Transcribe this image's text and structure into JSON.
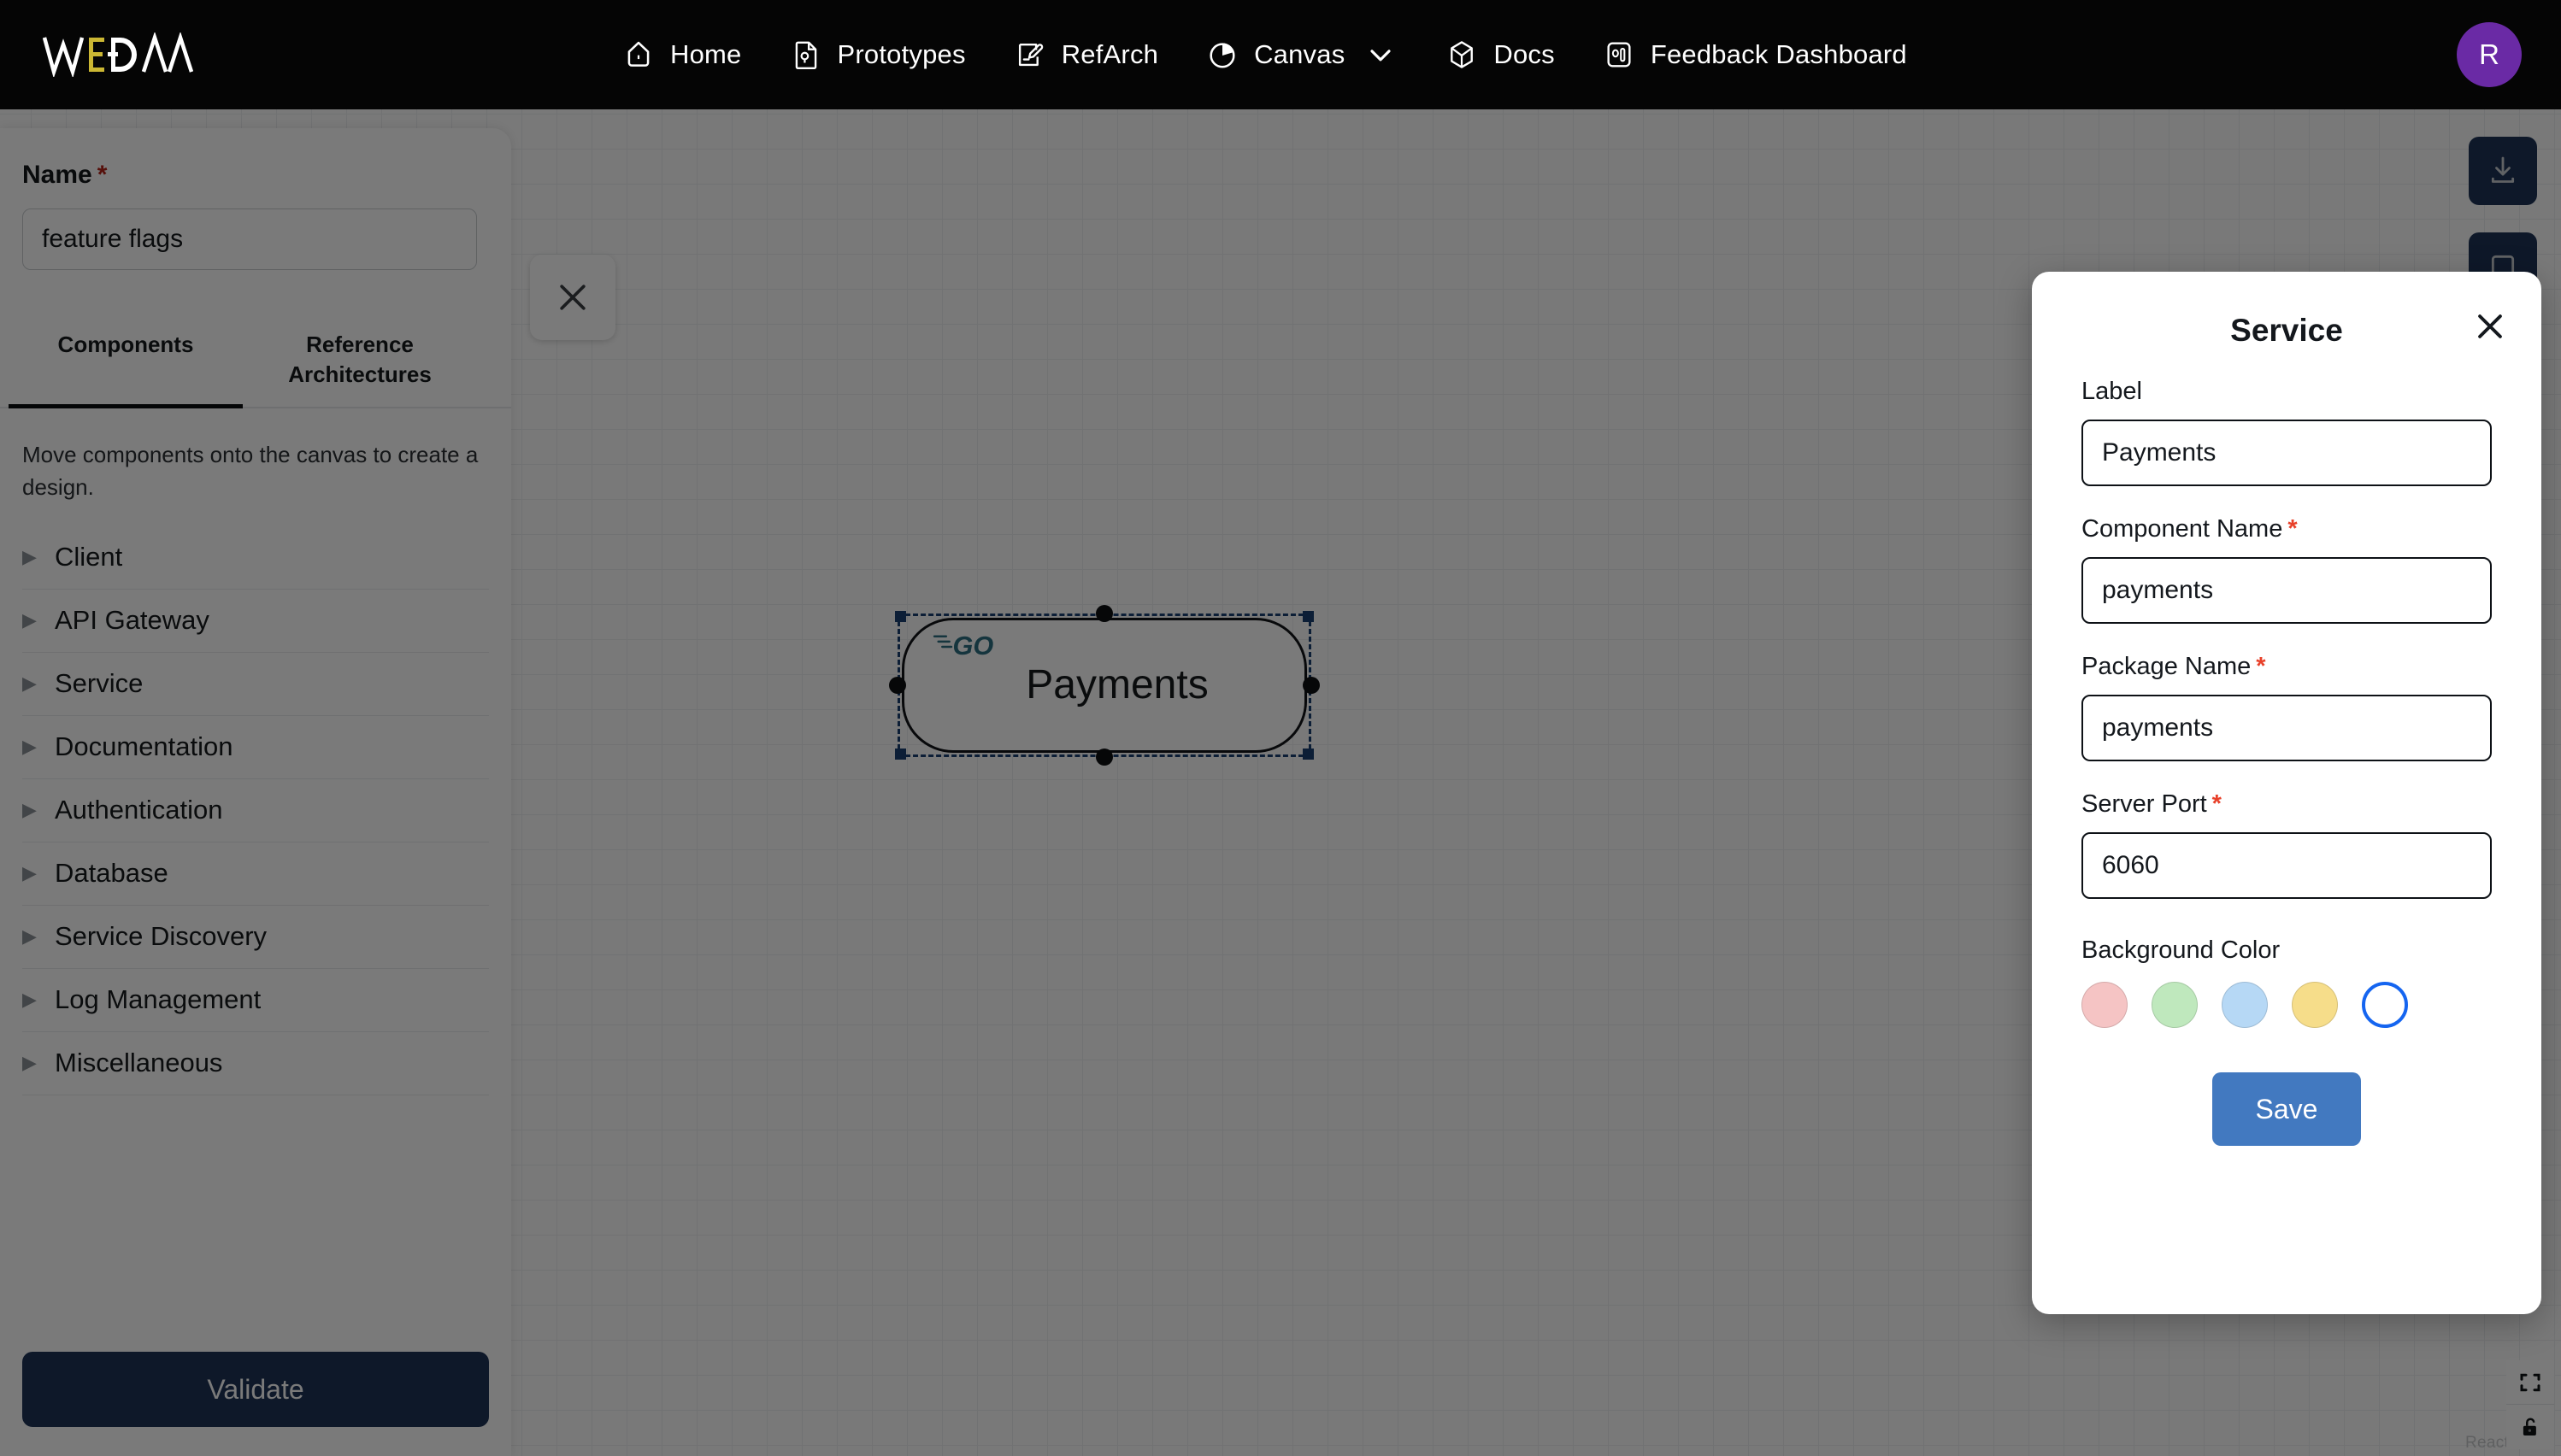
{
  "topnav": {
    "brand": "WEDAA",
    "brand_accent_color": "#cbb733",
    "items": [
      {
        "label": "Home",
        "icon": "home-icon"
      },
      {
        "label": "Prototypes",
        "icon": "prototype-file-icon"
      },
      {
        "label": "RefArch",
        "icon": "edit-document-icon"
      },
      {
        "label": "Canvas",
        "icon": "pie-chart-icon",
        "has_chevron": true
      },
      {
        "label": "Docs",
        "icon": "cube-icon"
      },
      {
        "label": "Feedback Dashboard",
        "icon": "bar-chart-icon"
      }
    ],
    "avatar": {
      "initial": "R",
      "color": "#6a2aa5"
    }
  },
  "left_panel": {
    "name_label": "Name",
    "name_required_mark": "*",
    "name_value": "feature flags",
    "name_placeholder": "Name",
    "tabs": [
      {
        "label": "Components",
        "active": true
      },
      {
        "label": "Reference Architectures",
        "active": false
      }
    ],
    "hint": "Move components onto the canvas to create a design.",
    "components": [
      {
        "label": "Client"
      },
      {
        "label": "API Gateway"
      },
      {
        "label": "Service"
      },
      {
        "label": "Documentation"
      },
      {
        "label": "Authentication"
      },
      {
        "label": "Database"
      },
      {
        "label": "Service Discovery"
      },
      {
        "label": "Log Management"
      },
      {
        "label": "Miscellaneous"
      }
    ],
    "validate_label": "Validate",
    "validate_color": "#1e3457"
  },
  "canvas": {
    "node": {
      "label": "Payments",
      "tech_logo": "go-lang-logo",
      "selected": true
    },
    "close_card_icon": "close-icon",
    "download_icon": "download-icon",
    "second_fab_icon": "action-icon",
    "controls": [
      {
        "icon": "fit-view-icon"
      },
      {
        "icon": "unlock-icon"
      }
    ],
    "attribution": "React Flow"
  },
  "dialog": {
    "title": "Service",
    "close_icon": "close-icon",
    "fields": [
      {
        "label": "Label",
        "required": false,
        "value": "Payments",
        "placeholder": "Label"
      },
      {
        "label": "Component Name",
        "required": true,
        "value": "payments",
        "placeholder": "Component Name"
      },
      {
        "label": "Package Name",
        "required": true,
        "value": "payments",
        "placeholder": "Package Name"
      },
      {
        "label": "Server Port",
        "required": true,
        "value": "6060",
        "placeholder": "Server Port"
      }
    ],
    "background_color_label": "Background Color",
    "swatches": [
      {
        "name": "pink",
        "hex": "#f5c4c4",
        "selected": false
      },
      {
        "name": "green",
        "hex": "#bfe8bd",
        "selected": false
      },
      {
        "name": "blue",
        "hex": "#b6d8f5",
        "selected": false
      },
      {
        "name": "yellow",
        "hex": "#f6dd8a",
        "selected": false
      },
      {
        "name": "white",
        "hex": "#ffffff",
        "selected": true
      }
    ],
    "save_label": "Save",
    "save_color": "#4279c0"
  }
}
